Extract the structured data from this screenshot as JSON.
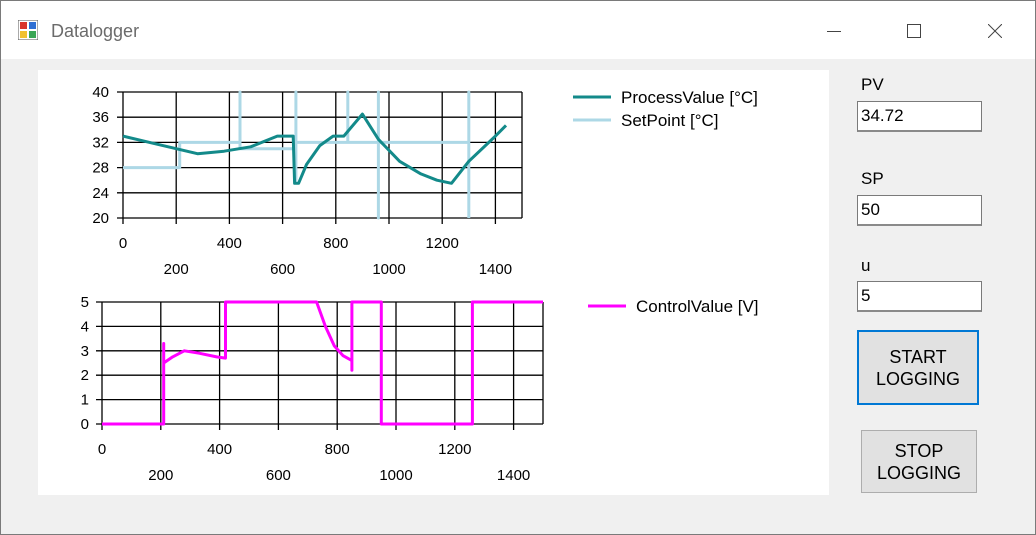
{
  "window": {
    "title": "Datalogger"
  },
  "fields": [
    {
      "label": "PV",
      "value": "34.72"
    },
    {
      "label": "SP",
      "value": "50"
    },
    {
      "label": "u",
      "value": "5"
    }
  ],
  "buttons": {
    "start": [
      "START",
      "LOGGING"
    ],
    "stop": [
      "STOP",
      "LOGGING"
    ]
  },
  "colors": {
    "process": "#138a8a",
    "setpoint": "#add8e6",
    "control": "#ff00ff"
  },
  "chart_data": [
    {
      "type": "line",
      "title": "",
      "xlabel": "",
      "ylabel": "",
      "xlim": [
        0,
        1500
      ],
      "ylim": [
        20,
        40
      ],
      "yticks": [
        20,
        24,
        28,
        32,
        36,
        40
      ],
      "xticks_top": [
        "0",
        "400",
        "800",
        "1200"
      ],
      "xticks_bottom": [
        "200",
        "600",
        "1000",
        "1400"
      ],
      "grid": true,
      "legend": "top-right",
      "series": [
        {
          "name": "ProcessValue [°C]",
          "color": "#138a8a",
          "points": [
            [
              0,
              33
            ],
            [
              100,
              32
            ],
            [
              200,
              31
            ],
            [
              280,
              30.2
            ],
            [
              380,
              30.6
            ],
            [
              480,
              31.3
            ],
            [
              580,
              33
            ],
            [
              640,
              33
            ],
            [
              645,
              25.5
            ],
            [
              660,
              25.5
            ],
            [
              690,
              28.5
            ],
            [
              740,
              31.5
            ],
            [
              790,
              33
            ],
            [
              830,
              33
            ],
            [
              900,
              36.5
            ],
            [
              960,
              32.5
            ],
            [
              1040,
              29
            ],
            [
              1120,
              27
            ],
            [
              1180,
              26
            ],
            [
              1235,
              25.5
            ],
            [
              1300,
              29
            ],
            [
              1400,
              33
            ],
            [
              1440,
              34.7
            ]
          ]
        },
        {
          "name": "SetPoint [°C]",
          "color": "#add8e6",
          "points": [
            [
              0,
              28
            ],
            [
              213,
              28
            ],
            [
              213,
              32
            ],
            [
              440,
              32
            ],
            [
              440,
              40
            ],
            [
              440,
              31
            ],
            [
              650,
              31
            ],
            [
              650,
              40
            ],
            [
              650,
              26
            ],
            [
              650,
              32
            ],
            [
              845,
              32
            ],
            [
              845,
              40
            ],
            [
              845,
              32
            ],
            [
              960,
              32
            ],
            [
              960,
              40
            ],
            [
              960,
              20
            ],
            [
              960,
              32
            ],
            [
              1300,
              32
            ],
            [
              1300,
              40
            ],
            [
              1300,
              20
            ]
          ]
        }
      ]
    },
    {
      "type": "line",
      "title": "",
      "xlabel": "",
      "ylabel": "",
      "xlim": [
        0,
        1500
      ],
      "ylim": [
        0,
        5
      ],
      "yticks": [
        0,
        1,
        2,
        3,
        4,
        5
      ],
      "xticks_top": [
        "0",
        "400",
        "800",
        "1200"
      ],
      "xticks_bottom": [
        "200",
        "600",
        "1000",
        "1400"
      ],
      "grid": true,
      "legend": "top-right",
      "series": [
        {
          "name": "ControlValue [V]",
          "color": "#ff00ff",
          "points": [
            [
              0,
              0
            ],
            [
              210,
              0
            ],
            [
              210,
              3.3
            ],
            [
              210,
              2.5
            ],
            [
              240,
              2.75
            ],
            [
              280,
              3
            ],
            [
              330,
              2.9
            ],
            [
              390,
              2.75
            ],
            [
              420,
              2.7
            ],
            [
              420,
              5
            ],
            [
              730,
              5
            ],
            [
              760,
              4
            ],
            [
              790,
              3.2
            ],
            [
              820,
              2.8
            ],
            [
              850,
              2.6
            ],
            [
              850,
              2.2
            ],
            [
              850,
              5
            ],
            [
              950,
              5
            ],
            [
              950,
              0
            ],
            [
              1260,
              0
            ],
            [
              1260,
              5
            ],
            [
              1500,
              5
            ]
          ]
        }
      ]
    }
  ]
}
